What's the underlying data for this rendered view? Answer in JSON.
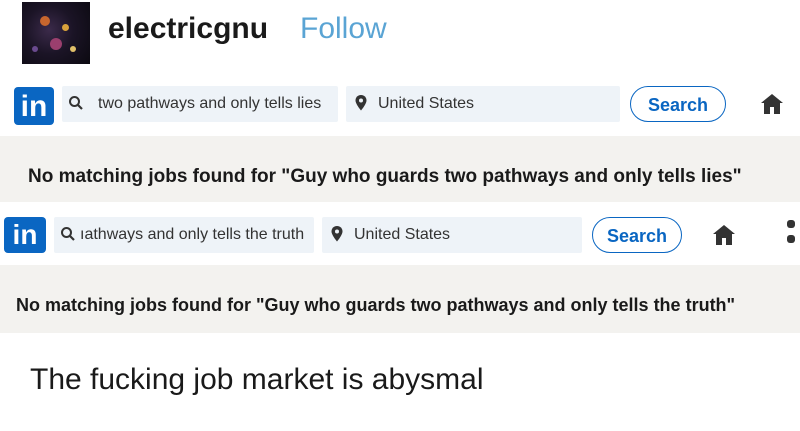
{
  "post": {
    "username": "electricgnu",
    "follow_label": "Follow",
    "caption": "The fucking job market is abysmal"
  },
  "screens": [
    {
      "logo_text": "in",
      "keywords": "two pathways and only tells lies",
      "location": "United States",
      "search_label": "Search",
      "message": "No matching jobs found for \"Guy who guards two pathways and only tells lies\""
    },
    {
      "logo_text": "in",
      "keywords": "ıathways and only tells the truth",
      "location": "United States",
      "search_label": "Search",
      "message": "No matching jobs found for \"Guy who guards two pathways and only tells the truth\""
    }
  ],
  "colors": {
    "linkedin_blue": "#0a66c2",
    "follow_blue": "#5aa4d4",
    "search_field_bg": "#eef3f8",
    "results_bg": "#f3f2ef"
  },
  "icons": [
    "search-icon",
    "location-pin-icon",
    "home-icon",
    "more-icon"
  ]
}
